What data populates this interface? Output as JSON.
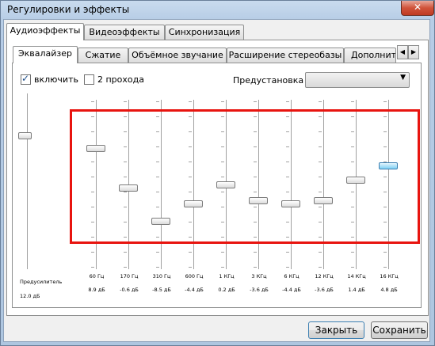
{
  "window": {
    "title": "Регулировки и эффекты",
    "close_glyph": "✕"
  },
  "tabs": [
    "Аудиоэффекты",
    "Видеоэффекты",
    "Синхронизация"
  ],
  "subtabs": [
    "Эквалайзер",
    "Сжатие",
    "Объёмное звучание",
    "Расширение стереобазы",
    "Дополнительно"
  ],
  "subtab_scroll": {
    "left": "◀",
    "right": "▶"
  },
  "options": {
    "enable_label": "включить",
    "enable_checked": true,
    "enable_mark": "✓",
    "two_pass_label": "2 прохода",
    "two_pass_checked": false
  },
  "preset": {
    "label": "Предустановка",
    "value": "",
    "arrow": "▼"
  },
  "preamp": {
    "label": "Предусилитель",
    "value_label": "12.0 дБ",
    "value": 12.0
  },
  "bands": [
    {
      "freq": "60 Гц",
      "value_label": "8.9 дБ",
      "value": 8.9
    },
    {
      "freq": "170 Гц",
      "value_label": "-0.6 дБ",
      "value": -0.6
    },
    {
      "freq": "310 Гц",
      "value_label": "-8.5 дБ",
      "value": -8.5
    },
    {
      "freq": "600 Гц",
      "value_label": "-4.4 дБ",
      "value": -4.4
    },
    {
      "freq": "1 КГц",
      "value_label": "0.2 дБ",
      "value": 0.2
    },
    {
      "freq": "3 КГц",
      "value_label": "-3.6 дБ",
      "value": -3.6
    },
    {
      "freq": "6 КГц",
      "value_label": "-4.4 дБ",
      "value": -4.4
    },
    {
      "freq": "12 КГц",
      "value_label": "-3.6 дБ",
      "value": -3.6
    },
    {
      "freq": "14 КГц",
      "value_label": "1.4 дБ",
      "value": 1.4
    },
    {
      "freq": "16 КГц",
      "value_label": "4.8 дБ",
      "value": 4.8
    }
  ],
  "colors": {
    "highlight": "#e8140f",
    "active_thumb": "#7fd0f4"
  },
  "buttons": {
    "close": "Закрыть",
    "save": "Сохранить"
  }
}
